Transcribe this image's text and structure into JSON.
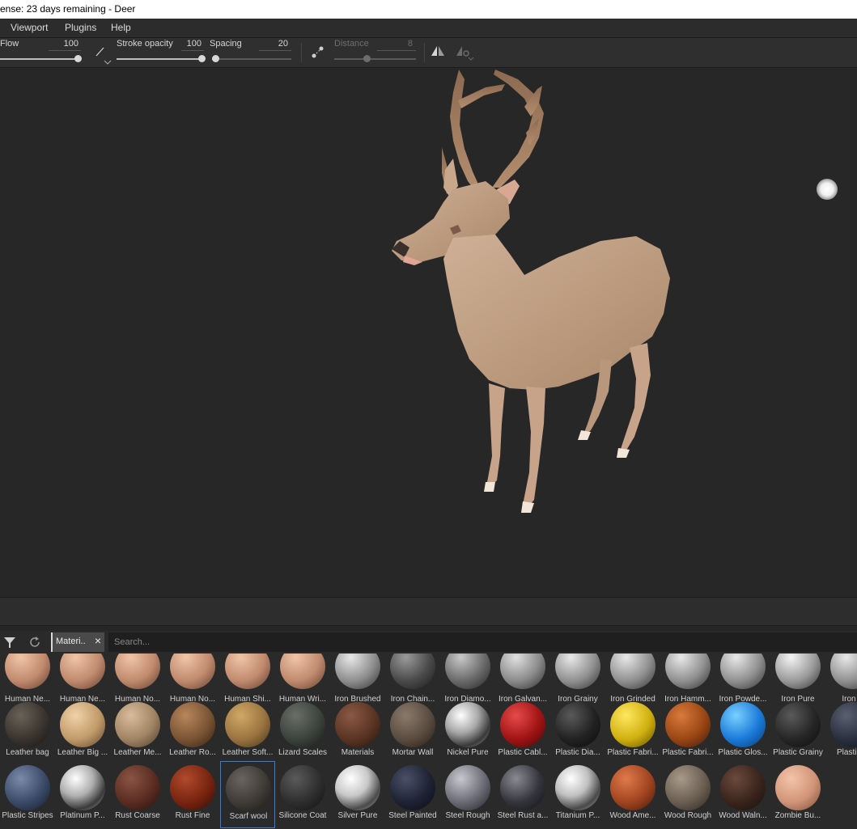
{
  "titlebar": {
    "title": "ense: 23 days remaining - Deer"
  },
  "menu": [
    "Viewport",
    "Plugins",
    "Help"
  ],
  "toolbar": {
    "flow": {
      "label": "Flow",
      "value": "100",
      "level": 1.0
    },
    "stroke_opacity": {
      "label": "Stroke opacity",
      "value": "100",
      "level": 1.0
    },
    "spacing": {
      "label": "Spacing",
      "value": "20",
      "level": 0.05
    },
    "distance": {
      "label": "Distance",
      "value": "8",
      "level": 0.4
    }
  },
  "shelf": {
    "tag_label": "Materi..",
    "search_placeholder": "Search..."
  },
  "materials": [
    [
      "Human Ne...",
      "Human Ne...",
      "Human No...",
      "Human No...",
      "Human Shi...",
      "Human Wri...",
      "Iron Brushed",
      "Iron Chain...",
      "Iron Diamo...",
      "Iron Galvan...",
      "Iron Grainy",
      "Iron Grinded",
      "Iron Hamm...",
      "Iron Powde...",
      "Iron Pure",
      "Iron R"
    ],
    [
      "Leather bag",
      "Leather Big ...",
      "Leather Me...",
      "Leather Ro...",
      "Leather Soft...",
      "Lizard Scales",
      "Materials",
      "Mortar Wall",
      "Nickel Pure",
      "Plastic Cabl...",
      "Plastic Dia...",
      "Plastic Fabri...",
      "Plastic Fabri...",
      "Plastic Glos...",
      "Plastic Grainy",
      "Plastic G"
    ],
    [
      "Plastic Stripes",
      "Platinum P...",
      "Rust Coarse",
      "Rust Fine",
      "Scarf wool",
      "Silicone Coat",
      "Silver Pure",
      "Steel Painted",
      "Steel Rough",
      "Steel Rust a...",
      "Titanium P...",
      "Wood Ame...",
      "Wood Rough",
      "Wood Waln...",
      "Zombie Bu..."
    ]
  ],
  "selected_material": "Scarf wool",
  "colors": {
    "selection": "#3a7bd5",
    "background": "#262626"
  }
}
